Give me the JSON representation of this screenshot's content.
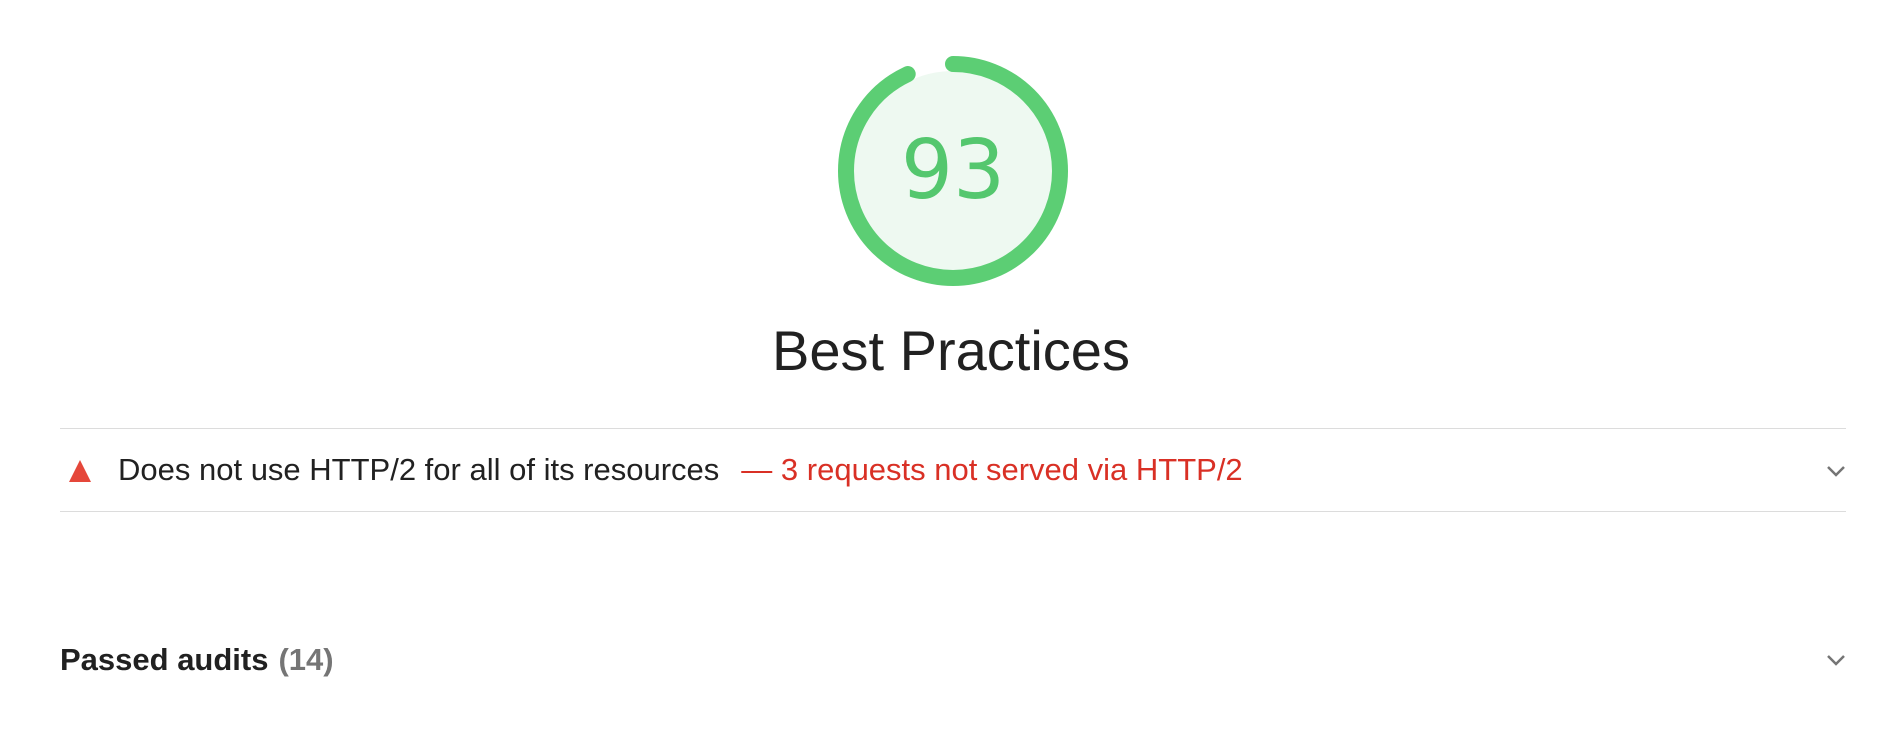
{
  "score": {
    "value": "93",
    "fraction": 0.93,
    "color": "#54c76e",
    "fill_color": "#eef9f1"
  },
  "category": {
    "title": "Best Practices"
  },
  "audit": {
    "icon": "warning-triangle-icon",
    "title": "Does not use HTTP/2 for all of its resources",
    "display_value": "— 3 requests not served via HTTP/2",
    "status_color": "#e5473a"
  },
  "passed": {
    "label": "Passed audits",
    "count": "(14)"
  }
}
